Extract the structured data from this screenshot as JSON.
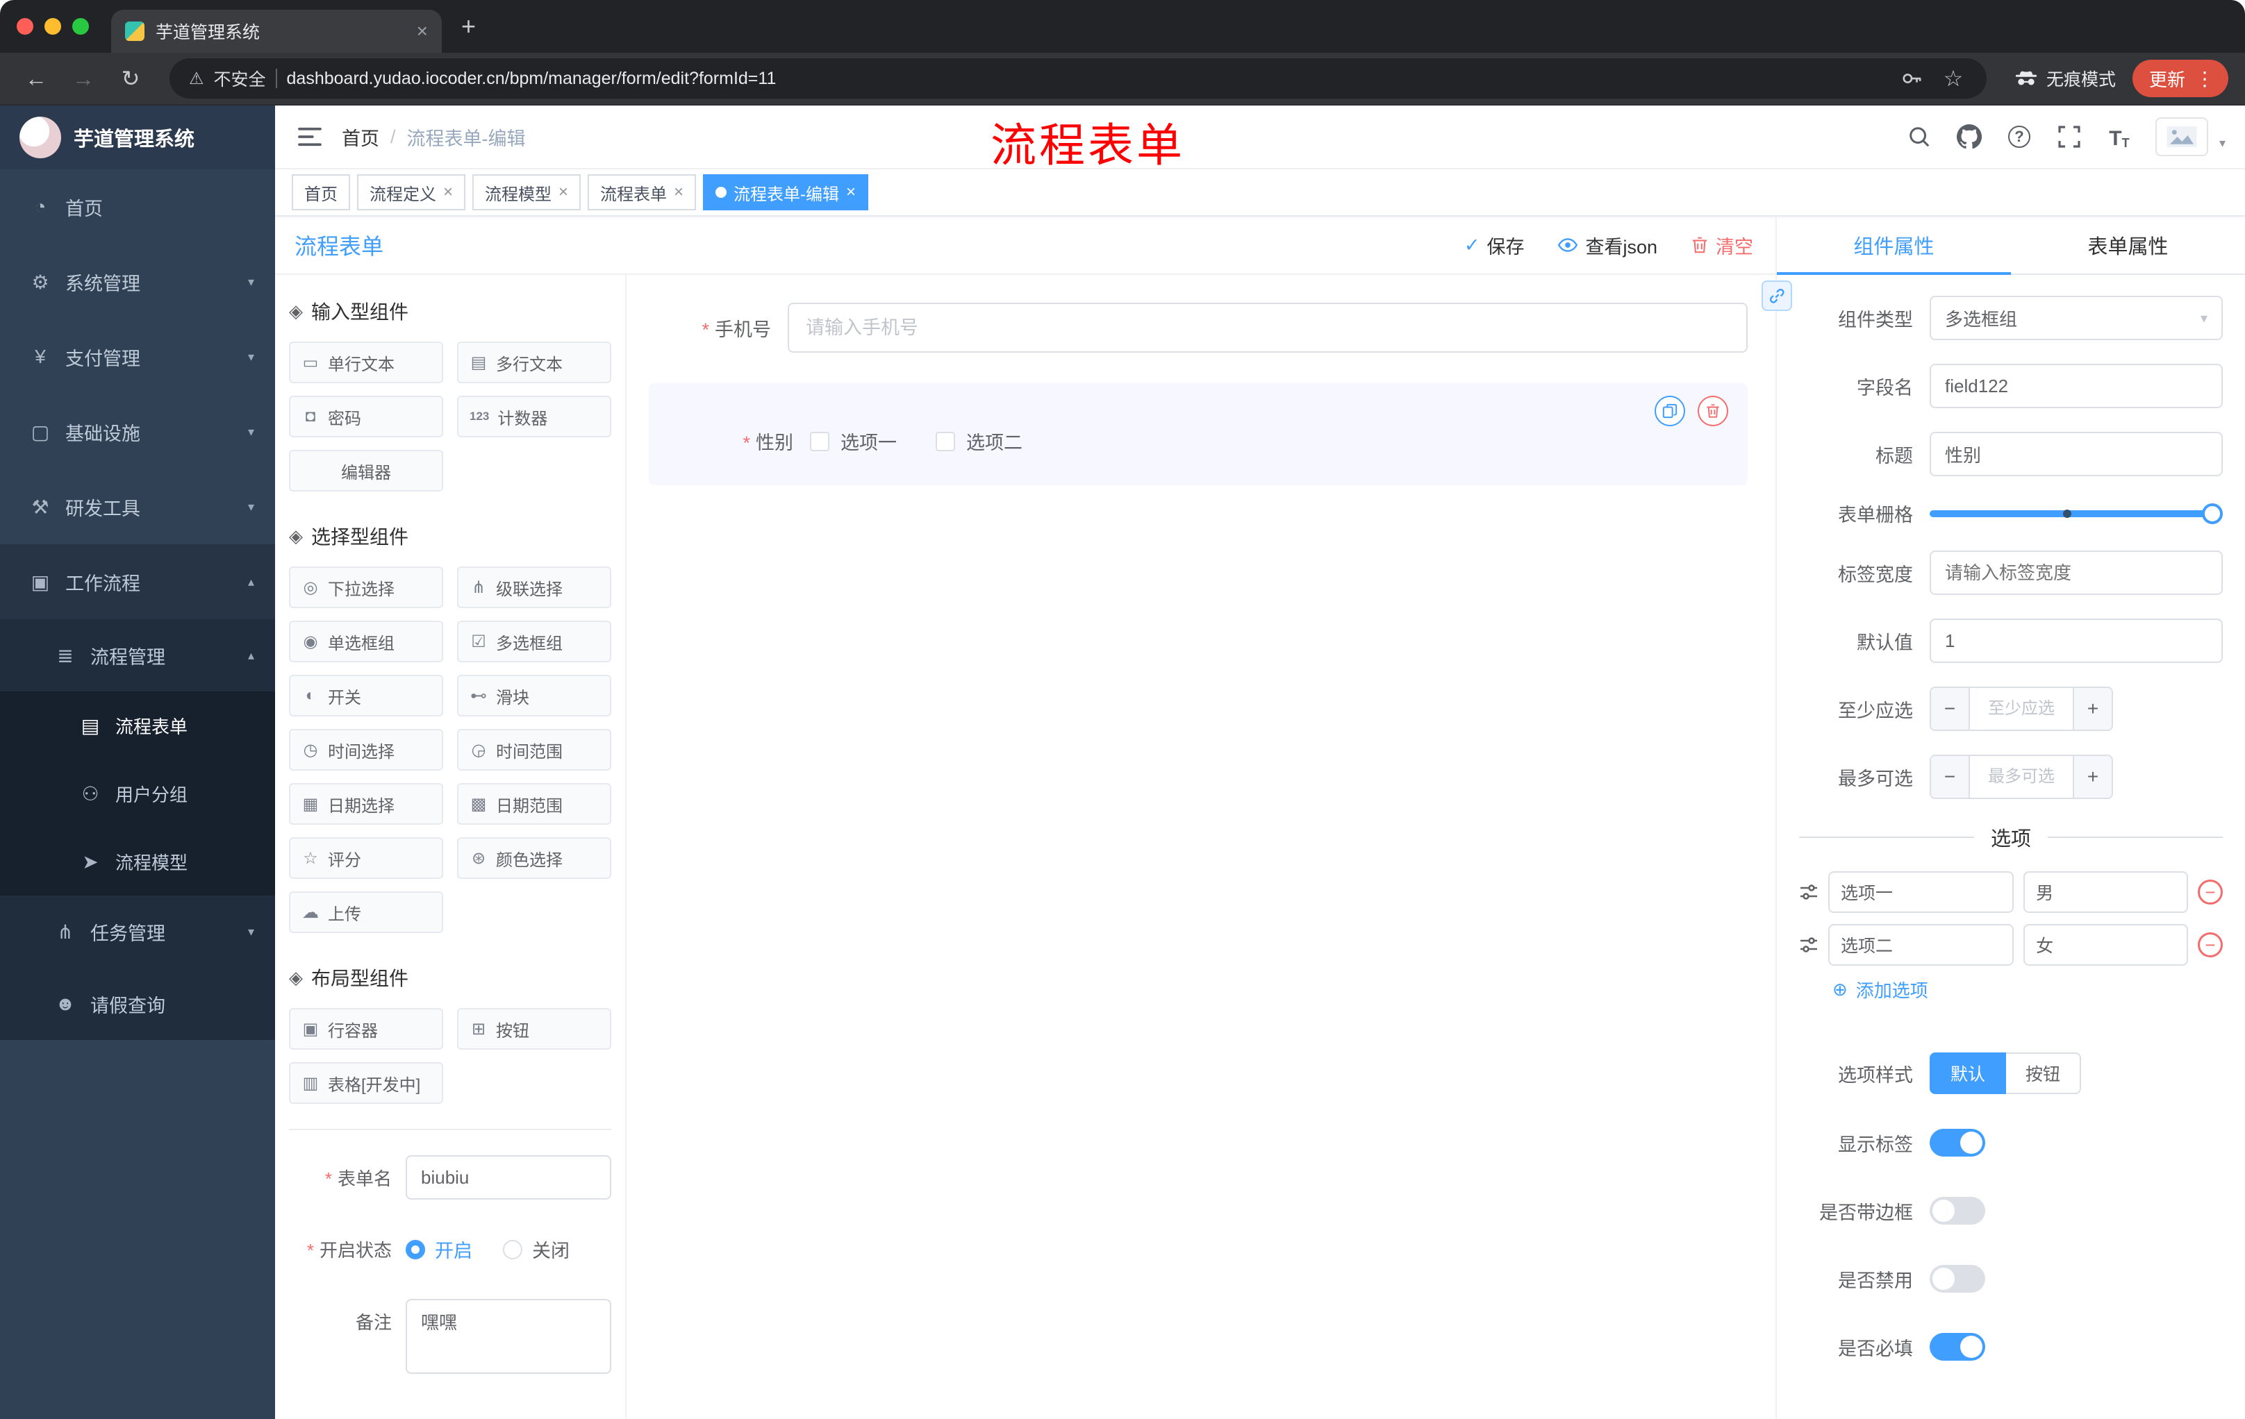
{
  "colors": {
    "primary": "#409EFF",
    "danger": "#F56C6C",
    "sidebar_bg": "#304156",
    "annotation": "#FF0000"
  },
  "icons": {
    "close": "×",
    "plus": "+",
    "minus": "−",
    "kebab": "⋮",
    "warning": "⚠",
    "star": "☆",
    "back": "←",
    "forward": "→",
    "reload": "↻",
    "chevron_down": "▾",
    "chevron_up": "▴",
    "caret_down": "▾",
    "check": "✓",
    "circle_plus": "⊕",
    "help": "?",
    "font_size": "T"
  },
  "browser": {
    "tab_title": "芋道管理系统",
    "security_label": "不安全",
    "url": "dashboard.yudao.iocoder.cn/bpm/manager/form/edit?formId=11",
    "incognito_label": "无痕模式",
    "update_label": "更新"
  },
  "annotation": {
    "text": "流程表单"
  },
  "sidebar": {
    "brand": "芋道管理系统",
    "menu": [
      {
        "label": "首页",
        "icon": "◔"
      },
      {
        "label": "系统管理",
        "icon": "⚙"
      },
      {
        "label": "支付管理",
        "icon": "¥"
      },
      {
        "label": "基础设施",
        "icon": "▢"
      },
      {
        "label": "研发工具",
        "icon": "⚒"
      },
      {
        "label": "工作流程",
        "icon": "▣"
      },
      {
        "label": "流程管理",
        "icon": "≣"
      },
      {
        "label": "流程表单",
        "icon": "▤"
      },
      {
        "label": "用户分组",
        "icon": "⚇"
      },
      {
        "label": "流程模型",
        "icon": "➤"
      },
      {
        "label": "任务管理",
        "icon": "⋔"
      },
      {
        "label": "请假查询",
        "icon": "☻"
      }
    ]
  },
  "navbar": {
    "breadcrumb": [
      "首页",
      "流程表单-编辑"
    ]
  },
  "tags": [
    {
      "label": "首页"
    },
    {
      "label": "流程定义"
    },
    {
      "label": "流程模型"
    },
    {
      "label": "流程表单"
    },
    {
      "label": "流程表单-编辑"
    }
  ],
  "designer": {
    "title": "流程表单",
    "actions": {
      "save": "保存",
      "view_json": "查看json",
      "clear": "清空"
    },
    "groups": [
      {
        "title": "输入型组件",
        "items": [
          {
            "icon": "▭",
            "label": "单行文本"
          },
          {
            "icon": "▤",
            "label": "多行文本"
          },
          {
            "icon": "◘",
            "label": "密码"
          },
          {
            "icon": "123",
            "label": "计数器"
          },
          {
            "icon": "",
            "label": "编辑器"
          }
        ]
      },
      {
        "title": "选择型组件",
        "items": [
          {
            "icon": "◎",
            "label": "下拉选择"
          },
          {
            "icon": "⋔",
            "label": "级联选择"
          },
          {
            "icon": "◉",
            "label": "单选框组"
          },
          {
            "icon": "☑",
            "label": "多选框组"
          },
          {
            "icon": "◐",
            "label": "开关"
          },
          {
            "icon": "⊷",
            "label": "滑块"
          },
          {
            "icon": "◷",
            "label": "时间选择"
          },
          {
            "icon": "◶",
            "label": "时间范围"
          },
          {
            "icon": "▦",
            "label": "日期选择"
          },
          {
            "icon": "▩",
            "label": "日期范围"
          },
          {
            "icon": "☆",
            "label": "评分"
          },
          {
            "icon": "⊛",
            "label": "颜色选择"
          },
          {
            "icon": "☁",
            "label": "上传"
          }
        ]
      },
      {
        "title": "布局型组件",
        "items": [
          {
            "icon": "▣",
            "label": "行容器"
          },
          {
            "icon": "⊞",
            "label": "按钮"
          },
          {
            "icon": "▥",
            "label": "表格[开发中]"
          }
        ]
      }
    ],
    "meta": {
      "form_name": {
        "label": "表单名",
        "value": "biubiu"
      },
      "status": {
        "label": "开启状态",
        "on": "开启",
        "off": "关闭",
        "selected": "开启"
      },
      "remark": {
        "label": "备注",
        "value": "嘿嘿"
      }
    },
    "canvas": {
      "phone": {
        "label": "手机号",
        "placeholder": "请输入手机号"
      },
      "gender": {
        "label": "性别",
        "option1": "选项一",
        "option2": "选项二"
      }
    }
  },
  "props": {
    "tabs": {
      "component": "组件属性",
      "form": "表单属性"
    },
    "active_tab": "组件属性",
    "fields": {
      "type": {
        "label": "组件类型",
        "value": "多选框组"
      },
      "field": {
        "label": "字段名",
        "value": "field122"
      },
      "title": {
        "label": "标题",
        "value": "性别"
      },
      "grid": {
        "label": "表单栅格"
      },
      "label_width": {
        "label": "标签宽度",
        "placeholder": "请输入标签宽度"
      },
      "default": {
        "label": "默认值",
        "value": "1"
      },
      "min": {
        "label": "至少应选",
        "placeholder": "至少应选"
      },
      "max": {
        "label": "最多可选",
        "placeholder": "最多可选"
      }
    },
    "options": {
      "title": "选项",
      "rows": [
        {
          "label": "选项一",
          "value": "男"
        },
        {
          "label": "选项二",
          "value": "女"
        }
      ],
      "add_label": "添加选项"
    },
    "option_style": {
      "label": "选项样式",
      "default": "默认",
      "button": "按钮",
      "selected": "默认"
    },
    "switches": [
      {
        "label": "显示标签",
        "on": true
      },
      {
        "label": "是否带边框",
        "on": false
      },
      {
        "label": "是否禁用",
        "on": false
      },
      {
        "label": "是否必填",
        "on": true
      }
    ]
  }
}
